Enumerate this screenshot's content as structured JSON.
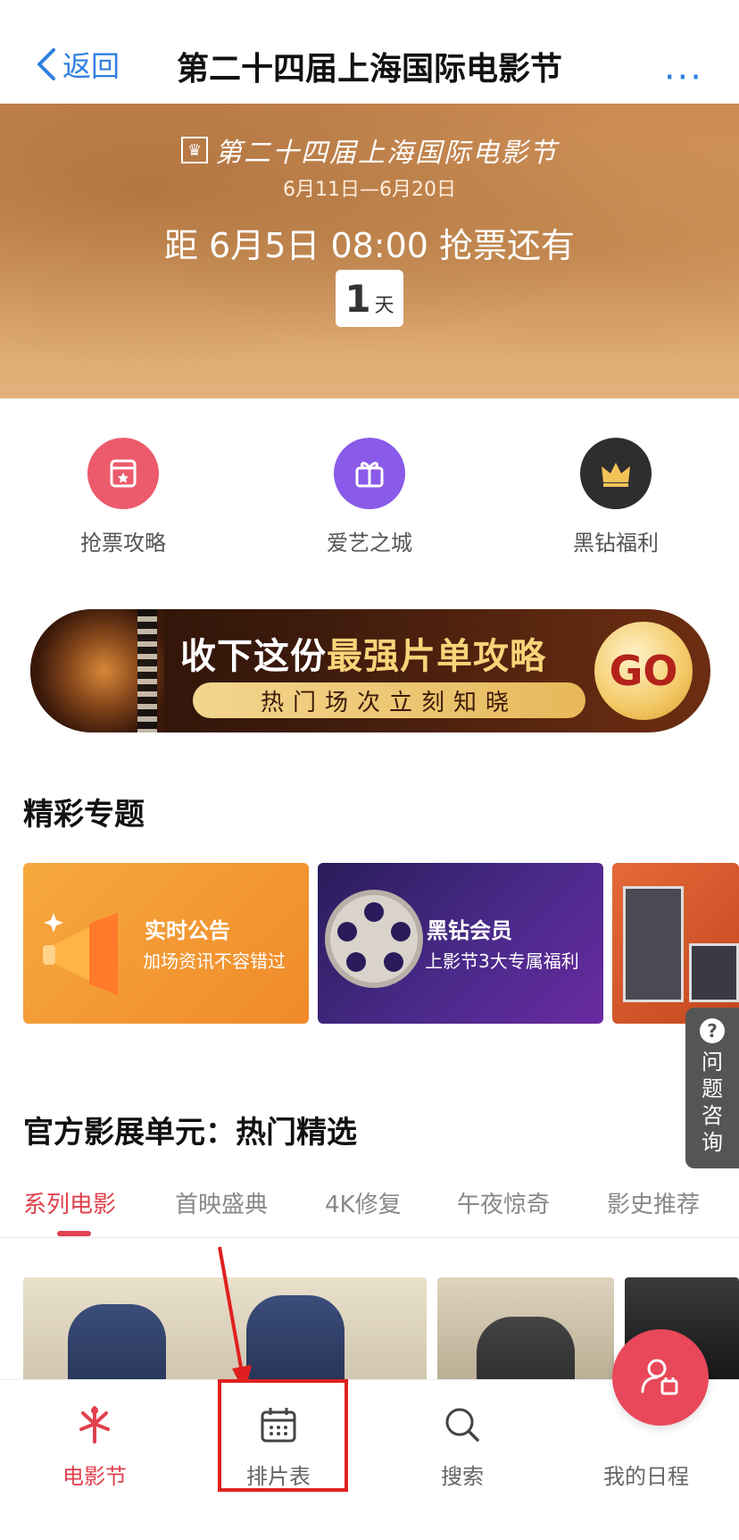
{
  "header": {
    "back_label": "返回",
    "title": "第二十四届上海国际电影节",
    "more_label": "···"
  },
  "banner": {
    "festival_name": "第二十四届上海国际电影节",
    "dates": "6月11日—6月20日",
    "countdown_text": "距 6月5日 08:00 抢票还有",
    "countdown_value": "1",
    "countdown_unit": "天"
  },
  "quick_entries": [
    {
      "label": "抢票攻略",
      "icon": "ticket-icon",
      "color": "#ec5b6b"
    },
    {
      "label": "爱艺之城",
      "icon": "gift-icon",
      "color": "#8a5ae8"
    },
    {
      "label": "黑钻福利",
      "icon": "crown-icon",
      "color": "#2e2e2e"
    }
  ],
  "promo": {
    "title_prefix": "收下这份",
    "title_highlight": "最强片单攻略",
    "subtitle": "热门场次立刻知晓",
    "go_label": "GO"
  },
  "featured": {
    "title": "精彩专题",
    "cards": [
      {
        "title": "实时公告",
        "subtitle": "加场资讯不容错过"
      },
      {
        "title": "黑钻会员",
        "subtitle": "上影节3大专属福利"
      }
    ]
  },
  "help": {
    "label": "问题咨询"
  },
  "official": {
    "title": "官方影展单元：热门精选",
    "tabs": [
      "系列电影",
      "首映盛典",
      "4K修复",
      "午夜惊奇",
      "影史推荐"
    ],
    "active_tab": "系列电影"
  },
  "bottom_nav": [
    {
      "label": "电影节",
      "icon": "festival-icon",
      "active": true
    },
    {
      "label": "排片表",
      "icon": "calendar-icon",
      "active": false
    },
    {
      "label": "搜索",
      "icon": "search-icon",
      "active": false
    },
    {
      "label": "我的日程",
      "icon": "profile-icon",
      "active": false
    }
  ],
  "colors": {
    "accent_blue": "#2f7fe0",
    "accent_red": "#e0414d",
    "annotation_red": "#e02020"
  }
}
